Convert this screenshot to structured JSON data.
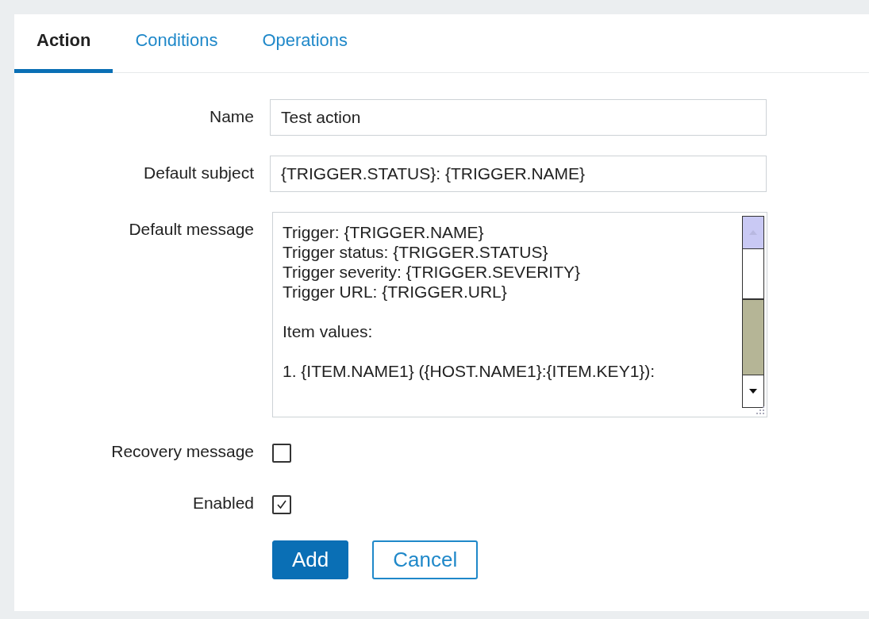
{
  "tabs": [
    {
      "label": "Action",
      "selected": true
    },
    {
      "label": "Conditions",
      "selected": false
    },
    {
      "label": "Operations",
      "selected": false
    }
  ],
  "form": {
    "name": {
      "label": "Name",
      "value": "Test action"
    },
    "default_subject": {
      "label": "Default subject",
      "value": "{TRIGGER.STATUS}: {TRIGGER.NAME}"
    },
    "default_message": {
      "label": "Default message",
      "value": "Trigger: {TRIGGER.NAME}\nTrigger status: {TRIGGER.STATUS}\nTrigger severity: {TRIGGER.SEVERITY}\nTrigger URL: {TRIGGER.URL}\n\nItem values:\n\n1. {ITEM.NAME1} ({HOST.NAME1}:{ITEM.KEY1}):"
    },
    "checkboxes": [
      {
        "label": "Recovery message",
        "checked": false
      },
      {
        "label": "Enabled",
        "checked": true
      }
    ]
  },
  "buttons": [
    {
      "label": "Add",
      "kind": "primary"
    },
    {
      "label": "Cancel",
      "kind": "secondary"
    }
  ]
}
